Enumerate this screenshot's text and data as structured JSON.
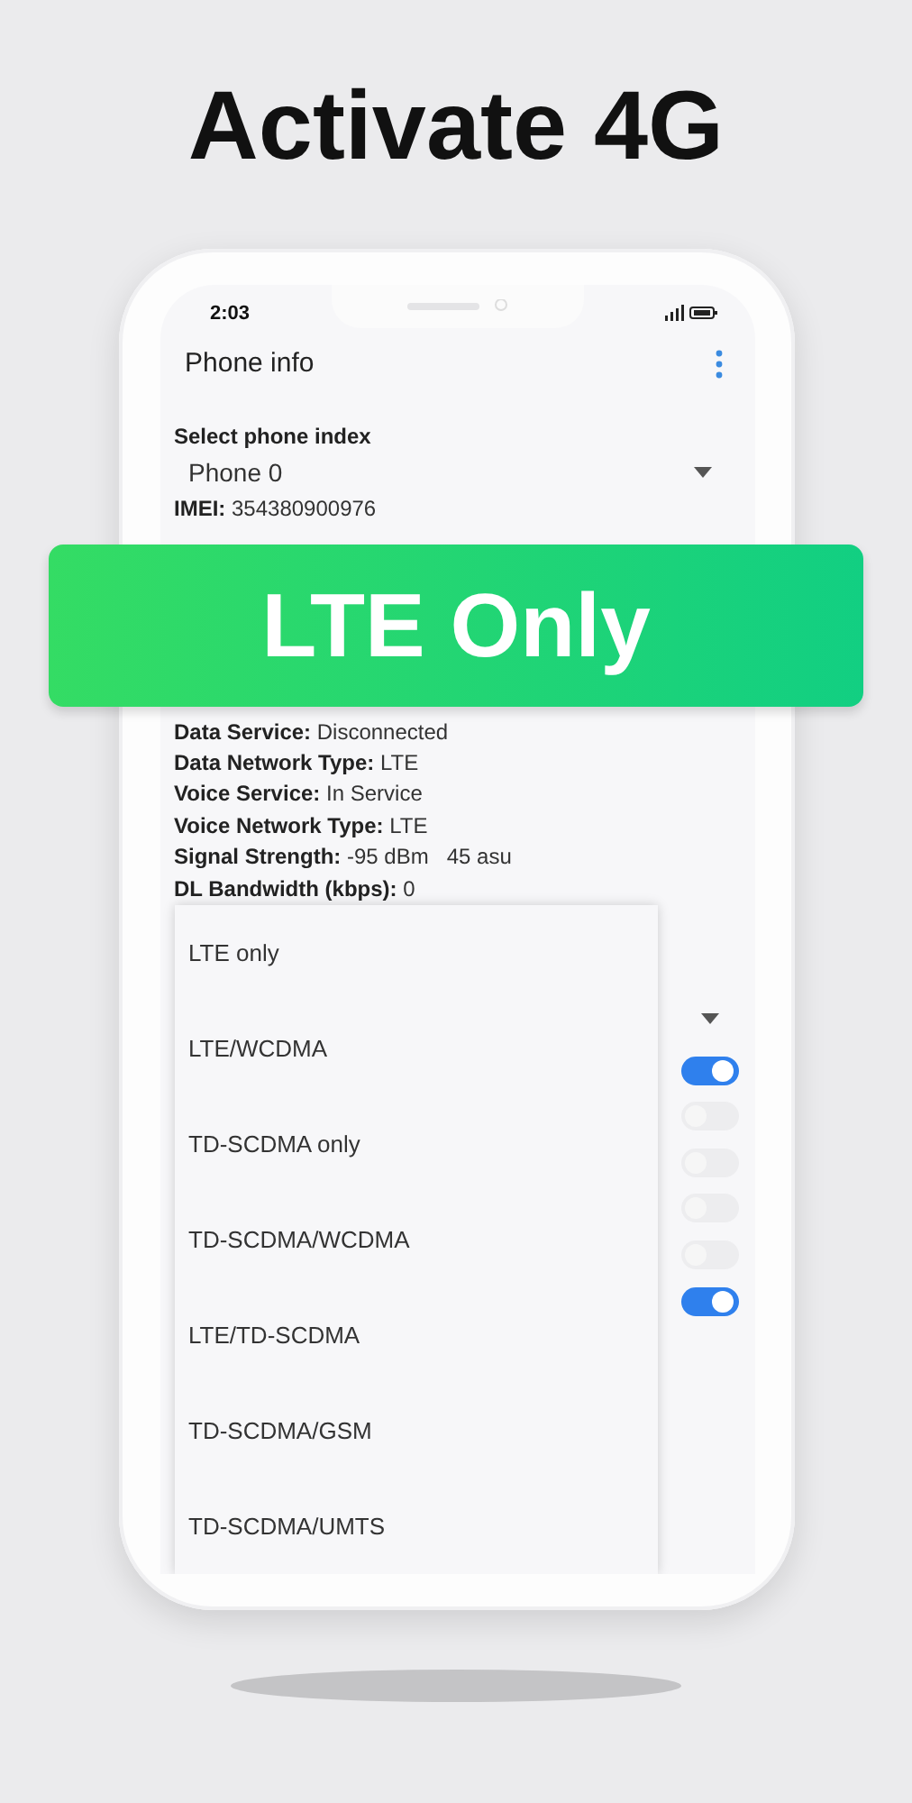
{
  "headline": "Activate 4G",
  "status_bar": {
    "time": "2:03"
  },
  "app_bar": {
    "title": "Phone info"
  },
  "phone_index": {
    "label": "Select phone index",
    "value": "Phone 0"
  },
  "info_top": [
    "**IMEI:** 354380900976"
  ],
  "info_bottom": [
    "**Data Service:** Disconnected",
    "**Data Network Type:** LTE",
    "**Voice Service:** In Service",
    "**Voice Network Type:** LTE",
    "**Signal Strength:** -95 dBm   45 asu",
    "**DL Bandwidth (kbps):** 0"
  ],
  "banner": {
    "text": "LTE Only"
  },
  "network_menu": {
    "options": [
      {
        "label": "LTE only"
      },
      {
        "label": "LTE/WCDMA"
      },
      {
        "label": "TD-SCDMA only"
      },
      {
        "label": "TD-SCDMA/WCDMA"
      },
      {
        "label": "LTE/TD-SCDMA"
      },
      {
        "label": "TD-SCDMA/GSM"
      },
      {
        "label": "TD-SCDMA/UMTS"
      }
    ]
  },
  "switches": [
    {
      "on": true
    },
    {
      "on": false
    },
    {
      "on": false
    },
    {
      "on": false
    },
    {
      "on": false
    },
    {
      "on": true
    }
  ]
}
